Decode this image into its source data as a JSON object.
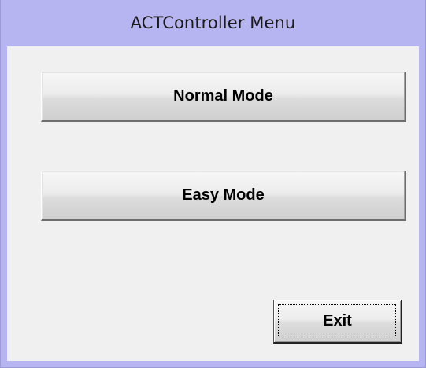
{
  "window": {
    "title": "ACTController Menu",
    "title_bar_color": "#b6b4f1",
    "client_color": "#f0f0f0"
  },
  "buttons": {
    "normal_mode": "Normal Mode",
    "easy_mode": "Easy Mode",
    "exit": "Exit"
  }
}
